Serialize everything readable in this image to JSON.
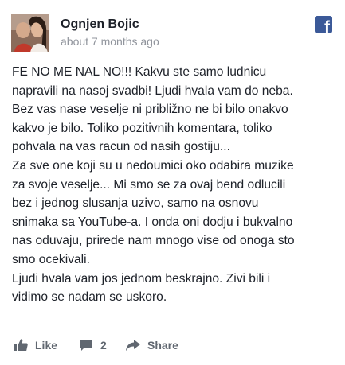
{
  "post": {
    "author": "Ognjen Bojic",
    "timestamp": "about 7 months ago",
    "source_icon": "facebook-icon",
    "source_glyph": "f",
    "paragraphs": [
      "FE NO ME NAL NO!!! Kakvu ste samo ludnicu",
      "napravili na nasoj svadbi! Ljudi hvala vam do neba.",
      "Bez vas nase veselje ni približno ne bi bilo onakvo",
      "kakvo je bilo. Toliko pozitivnih komentara, toliko",
      "pohvala na vas racun od nasih gostiju...",
      "Za sve one koji su u nedoumici oko odabira muzike",
      "za svoje veselje... Mi smo se za ovaj bend odlucili",
      "bez i jednog slusanja uzivo, samo na osnovu",
      "snimaka sa YouTube-a. I onda oni dodju i bukvalno",
      "nas oduvaju, prirede nam mnogo vise od onoga sto",
      "smo ocekivali.",
      "Ljudi hvala vam jos jednom beskrajno. Zivi bili i",
      "vidimo se nadam se uskoro."
    ]
  },
  "actions": {
    "like_label": "Like",
    "comment_count": "2",
    "share_label": "Share"
  },
  "colors": {
    "facebook_blue": "#3b5998",
    "action_gray": "#606770",
    "text": "#1d2129",
    "meta_gray": "#90949c"
  }
}
